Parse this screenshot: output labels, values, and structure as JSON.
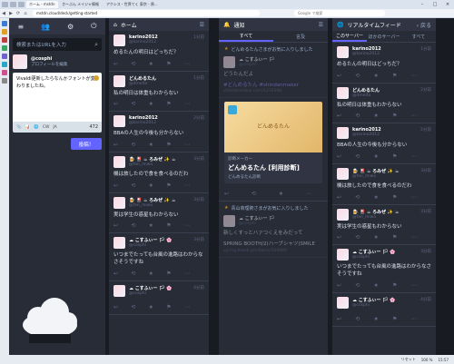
{
  "browser": {
    "tabs": [
      "ホーム - mstdn",
      "か~ぶん メイジャ情報",
      "アクシス・世界てく 東京 - 原..."
    ],
    "url": "mstdn.cloud/deck/getting-started",
    "search_placeholder": "Google で検索",
    "status": [
      "リセット",
      "100 %",
      "15:57"
    ]
  },
  "compose": {
    "nav": [
      "≡",
      "👥",
      "⚙",
      "⏻"
    ],
    "search_placeholder": "検索またはURLを入力",
    "profile_name": "@cosphi",
    "profile_edit": "プロフィールを編集",
    "text": "Vivaldi更新したらなんかフォントが変わりましたね。",
    "tools": [
      "📎",
      "📊",
      "🌐",
      "CW",
      "JA"
    ],
    "char_count": "472",
    "toot_label": "投稿！"
  },
  "home": {
    "title": "ホーム",
    "statuses": [
      {
        "name": "karino2012",
        "acct": "@karino2012",
        "time": "1分前",
        "body": "めるたんの明日はどっちだ？"
      },
      {
        "name": "どんめるたん",
        "acct": "@dmelta",
        "time": "1分前",
        "body": "私の明日は体重もわからない"
      },
      {
        "name": "karino2012",
        "acct": "@karino2012",
        "time": "2分前",
        "body": "BBAの人生の今後も分からない"
      },
      {
        "name": "🍺 🎴 ☕ ろみぜ ✨ ☕",
        "acct": "@fan_miwa",
        "time": "3分前",
        "body": "機は旅したので食を食べるのだわ"
      },
      {
        "name": "🍺 🎴 ☕ ろみぜ ✨ ☕",
        "acct": "@fan_miwa",
        "time": "3分前",
        "body": "実は学生の惑星もわからない"
      },
      {
        "name": "☁ こすふぃー 🏳 🌸",
        "acct": "@cosphi",
        "time": "3分前",
        "body": "いつまでたっても台風の進路はわからなさそうですね"
      },
      {
        "name": "☁ こすふぃー 🏳 🌸",
        "acct": "@cosphi",
        "time": "4分前",
        "body": ""
      }
    ]
  },
  "notifications": {
    "title": "通知",
    "tabs": [
      "すべて",
      "言及"
    ],
    "items": [
      {
        "line": "どんめるたんさまがお気に入りしました",
        "name": "☁ こすふぃー 🏳",
        "acct": "@cosphi",
        "body": "どうたんだよ"
      },
      {
        "line": "#どんめるたん #shindanmaker",
        "name": "",
        "acct": "shindanmaker.com/1216398",
        "body": ""
      }
    ],
    "card": {
      "image_text": "どんめるたん",
      "site": "診断メーカー",
      "title": "どんめるたん [利用診断]",
      "subtitle": "どんめるたん診断"
    },
    "more": [
      {
        "line": "青山商理術さまがお気に入りしました",
        "name": "☁ こすふぃー 🏳",
        "acct": "@cosphi",
        "body": "新しくすっとハァつくえをみだって"
      },
      {
        "line": "SPRING BOOTH/2(ハーブシャツ)SMILE",
        "name": "",
        "acct": "spring.booth.pm/items/569989",
        "body": ""
      }
    ]
  },
  "realtime": {
    "title": "リアルタイムフィード",
    "back_label": "戻る",
    "tabs": [
      "このサーバー",
      "ほかのサーバー",
      "すべて"
    ],
    "statuses": [
      {
        "name": "karino2012",
        "acct": "@karino2012",
        "time": "1分前",
        "body": "めるたんの明日はどっちだ？"
      },
      {
        "name": "どんめるたん",
        "acct": "@dmelta",
        "time": "2分前",
        "body": "私の明日は体重もわからない"
      },
      {
        "name": "karino2012",
        "acct": "@karino2012",
        "time": "2分前",
        "body": "BBAの人生の今後も分からない"
      },
      {
        "name": "🍺 🎴 ☕ ろみぜ ✨ ☕",
        "acct": "@fan_miwa",
        "time": "3分前",
        "body": "機は旅したので食を食べるのだわ"
      },
      {
        "name": "🍺 🎴 ☕ ろみぜ ✨ ☕",
        "acct": "@fan_miwa",
        "time": "3分前",
        "body": "実は学生の惑星もわからない"
      },
      {
        "name": "☁ こすふぃー 🏳 🌸",
        "acct": "@cosphi",
        "time": "3分前",
        "body": "いつまでたっても台風の進路はわからなさそうですね"
      },
      {
        "name": "☁ こすふぃー 🏳 🌸",
        "acct": "@cosphi",
        "time": "4分前",
        "body": ""
      }
    ]
  }
}
